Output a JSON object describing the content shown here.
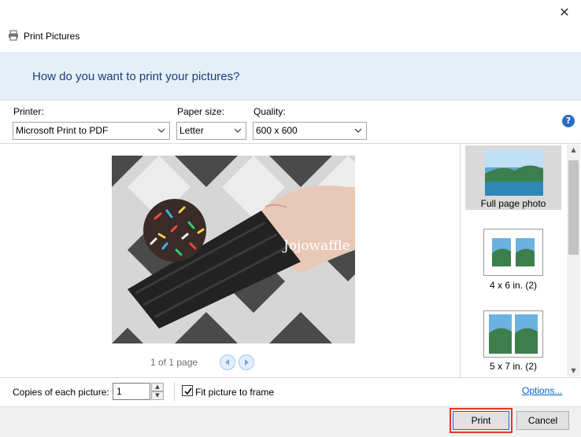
{
  "window": {
    "title": "Print Pictures",
    "close_glyph": "✕"
  },
  "banner": {
    "question": "How do you want to print your pictures?"
  },
  "settings": {
    "printer": {
      "label": "Printer:",
      "value": "Microsoft Print to PDF"
    },
    "paper_size": {
      "label": "Paper size:",
      "value": "Letter"
    },
    "quality": {
      "label": "Quality:",
      "value": "600 x 600"
    },
    "help_glyph": "?"
  },
  "preview": {
    "photo_watermark": "Jojowaffle",
    "page_count": "1 of 1 page"
  },
  "layouts": {
    "items": [
      {
        "label": "Full page photo",
        "selected": true
      },
      {
        "label": "4 x 6 in. (2)",
        "selected": false
      },
      {
        "label": "5 x 7 in. (2)",
        "selected": false
      }
    ]
  },
  "options": {
    "copies_label": "Copies of each picture:",
    "copies_value": "1",
    "fit_label": "Fit picture to frame",
    "fit_checked": true,
    "options_link": "Options..."
  },
  "buttons": {
    "print": "Print",
    "cancel": "Cancel"
  },
  "colors": {
    "banner_bg": "#e5eff8",
    "banner_text": "#1e3d78",
    "link": "#0066cc",
    "highlight": "#e53a1e"
  }
}
